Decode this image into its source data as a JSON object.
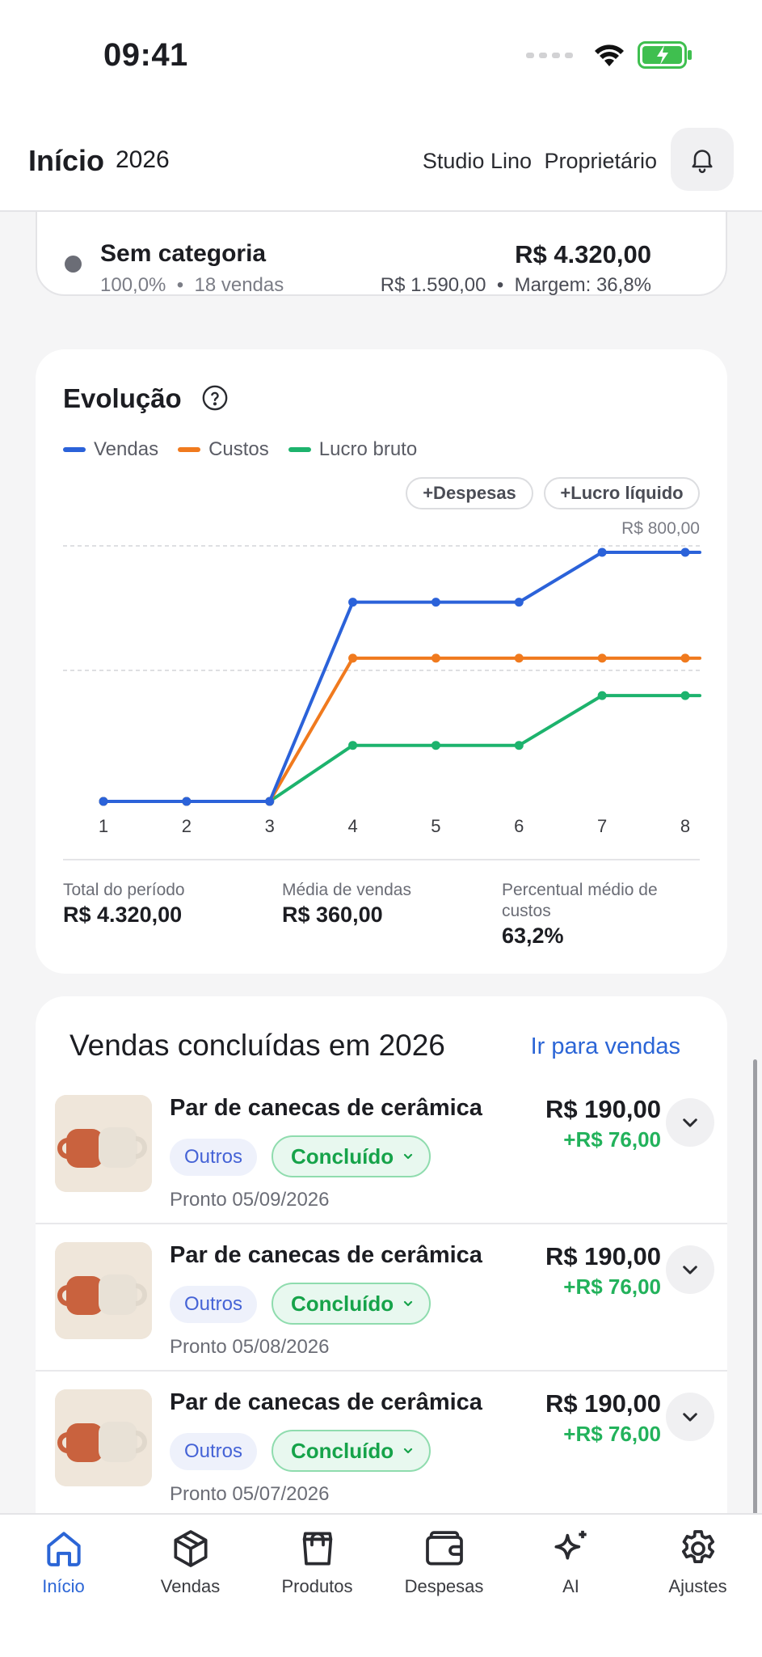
{
  "status_bar": {
    "time": "09:41"
  },
  "header": {
    "title": "Início",
    "year": "2026",
    "studio": "Studio Lino",
    "role": "Proprietário"
  },
  "category_card": {
    "name": "Sem categoria",
    "percent": "100,0%",
    "sales": "18 vendas",
    "total": "R$ 4.320,00",
    "cost": "R$ 1.590,00",
    "margin": "Margem: 36,8%"
  },
  "evolution": {
    "title": "Evolução",
    "chips": {
      "expenses": "+Despesas",
      "net_profit": "+Lucro líquido"
    },
    "summary": {
      "total_label": "Total do período",
      "total_value": "R$ 4.320,00",
      "avg_label": "Média de vendas",
      "avg_value": "R$ 360,00",
      "cost_pct_label": "Percentual médio de custos",
      "cost_pct_value": "63,2%"
    }
  },
  "chart_data": {
    "type": "line",
    "title": "",
    "x": [
      1,
      2,
      3,
      4,
      5,
      6,
      7,
      8
    ],
    "y_top_label": "R$ 800,00",
    "ylim": [
      0,
      800
    ],
    "grid": true,
    "legend_position": "top-left",
    "series": [
      {
        "name": "Vendas",
        "color": "#2b62d9",
        "values": [
          0,
          0,
          0,
          640,
          640,
          640,
          800,
          800
        ]
      },
      {
        "name": "Custos",
        "color": "#f07a1e",
        "values": [
          0,
          0,
          0,
          460,
          460,
          460,
          460,
          460
        ]
      },
      {
        "name": "Lucro bruto",
        "color": "#1db36d",
        "values": [
          0,
          0,
          0,
          180,
          180,
          180,
          340,
          340
        ]
      }
    ]
  },
  "sales": {
    "title": "Vendas concluídas em 2026",
    "link": "Ir para vendas",
    "items": [
      {
        "name": "Par de canecas de cerâmica",
        "category": "Outros",
        "status": "Concluído",
        "date": "Pronto 05/09/2026",
        "price": "R$ 190,00",
        "profit": "+R$ 76,00"
      },
      {
        "name": "Par de canecas de cerâmica",
        "category": "Outros",
        "status": "Concluído",
        "date": "Pronto 05/08/2026",
        "price": "R$ 190,00",
        "profit": "+R$ 76,00"
      },
      {
        "name": "Par de canecas de cerâmica",
        "category": "Outros",
        "status": "Concluído",
        "date": "Pronto 05/07/2026",
        "price": "R$ 190,00",
        "profit": "+R$ 76,00"
      }
    ]
  },
  "tabs": [
    {
      "label": "Início",
      "icon": "home-icon",
      "active": true
    },
    {
      "label": "Vendas",
      "icon": "box-icon"
    },
    {
      "label": "Produtos",
      "icon": "bag-icon"
    },
    {
      "label": "Despesas",
      "icon": "wallet-icon"
    },
    {
      "label": "AI",
      "icon": "sparkles-icon"
    },
    {
      "label": "Ajustes",
      "icon": "gear-icon"
    }
  ],
  "colors": {
    "accent": "#2b65d6",
    "success": "#16a34a"
  }
}
